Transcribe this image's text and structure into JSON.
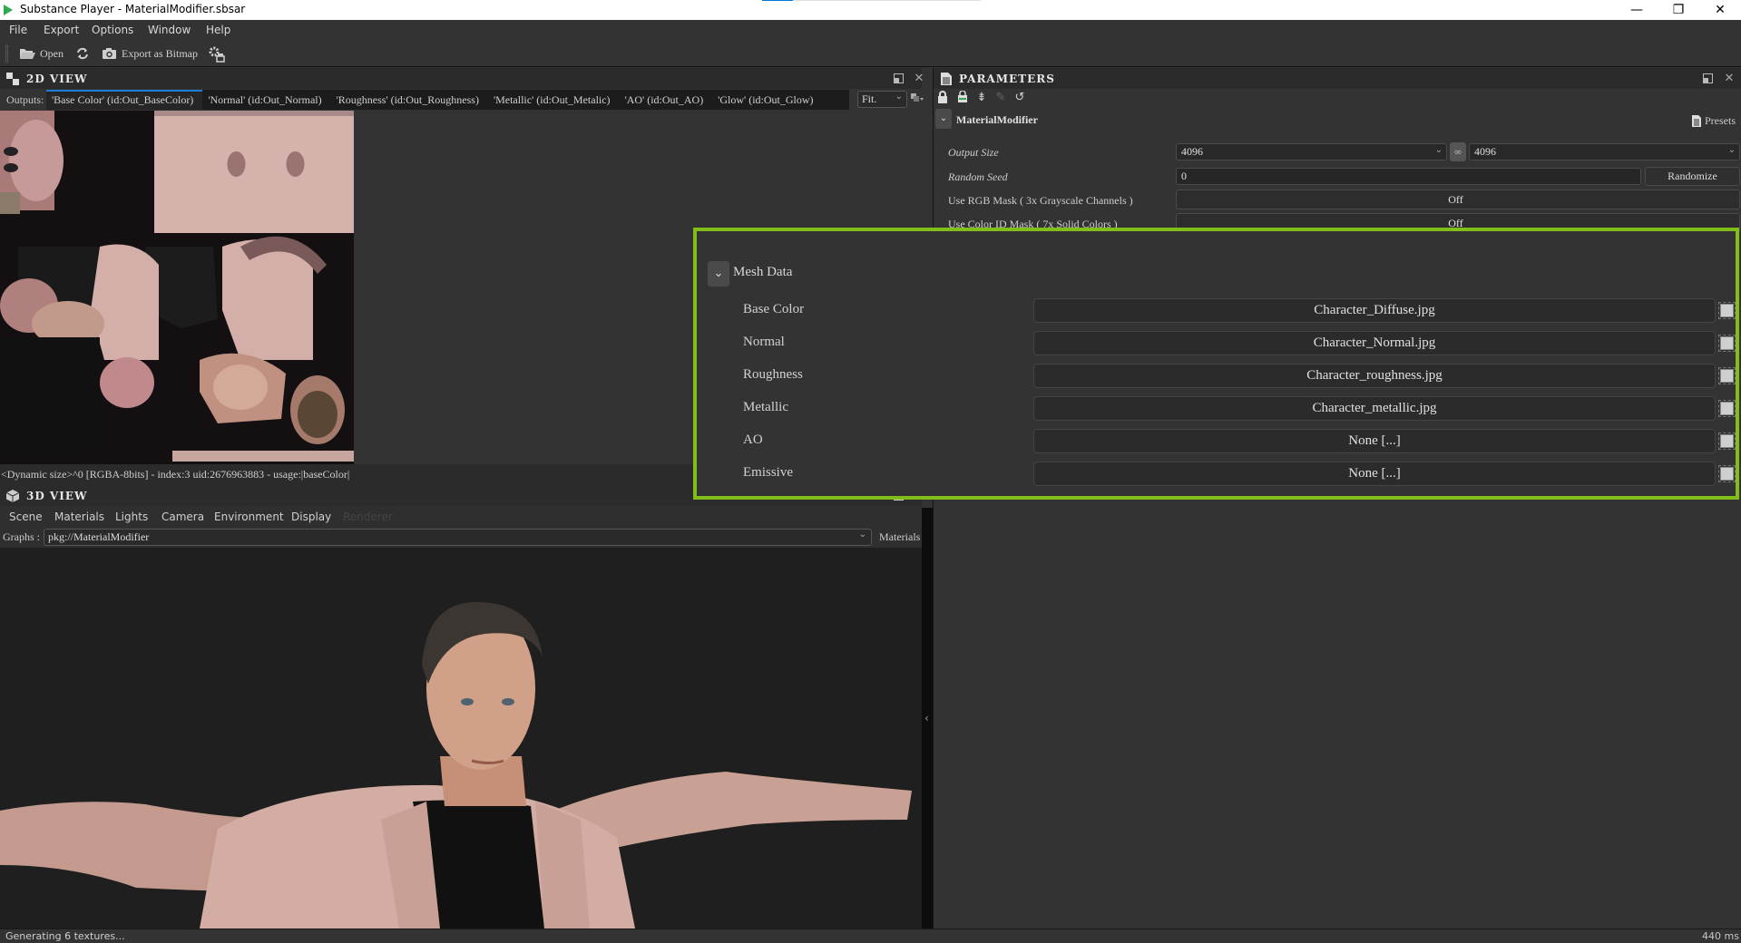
{
  "window": {
    "title": "Substance Player - MaterialModifier.sbsar",
    "progress_fraction": 0.14,
    "minimize": "—",
    "restore": "❐",
    "close": "✕"
  },
  "menu": [
    "File",
    "Export",
    "Options",
    "Window",
    "Help"
  ],
  "toolbar": {
    "open_label": "Open",
    "export_label": "Export as Bitmap",
    "icons": {
      "open": "folder-open-icon",
      "refresh": "refresh-icon",
      "camera": "camera-icon",
      "settings": "render-settings-icon"
    }
  },
  "view2d": {
    "title": "2D VIEW",
    "outputs_label": "Outputs:",
    "outputs": [
      "'Base Color' (id:Out_BaseColor)",
      "'Normal' (id:Out_Normal)",
      "'Roughness' (id:Out_Roughness)",
      "'Metallic' (id:Out_Metalic)",
      "'AO' (id:Out_AO)",
      "'Glow' (id:Out_Glow)"
    ],
    "active_output": 0,
    "zoom_mode": "Fit.",
    "texture_info": "<Dynamic size>^0 [RGBA-8bits] - index:3 uid:2676963883 - usage:|baseColor|"
  },
  "view3d": {
    "title": "3D VIEW",
    "tabs": [
      "Scene",
      "Materials",
      "Lights",
      "Camera",
      "Environment",
      "Display",
      "Renderer"
    ],
    "disabled_tabs": [
      "Renderer"
    ],
    "graphs_label": "Graphs :",
    "graphs_value": "pkg://MaterialModifier",
    "materials_label": "Materials"
  },
  "parameters": {
    "title": "PARAMETERS",
    "graph_name": "MaterialModifier",
    "presets_label": "Presets",
    "rows": {
      "output_size": {
        "label": "Output Size",
        "value_x": "4096",
        "value_y": "4096"
      },
      "random_seed": {
        "label": "Random Seed",
        "value": "0",
        "button": "Randomize"
      },
      "rgb_mask": {
        "label": "Use RGB Mask ( 3x Grayscale Channels )",
        "value": "Off"
      },
      "color_id_mask": {
        "label": "Use Color ID Mask ( 7x Solid Colors )",
        "value": "Off"
      }
    }
  },
  "mesh_data": {
    "title": "Mesh Data",
    "highlight_color": "#82bd1a",
    "items": [
      {
        "label": "Base Color",
        "value": "Character_Diffuse.jpg"
      },
      {
        "label": "Normal",
        "value": "Character_Normal.jpg"
      },
      {
        "label": "Roughness",
        "value": "Character_roughness.jpg"
      },
      {
        "label": "Metallic",
        "value": "Character_metallic.jpg"
      },
      {
        "label": "AO",
        "value": "None [...]"
      },
      {
        "label": "Emissive",
        "value": "None [...]"
      }
    ]
  },
  "status": {
    "message": "Generating 6 textures...",
    "time": "440 ms"
  }
}
